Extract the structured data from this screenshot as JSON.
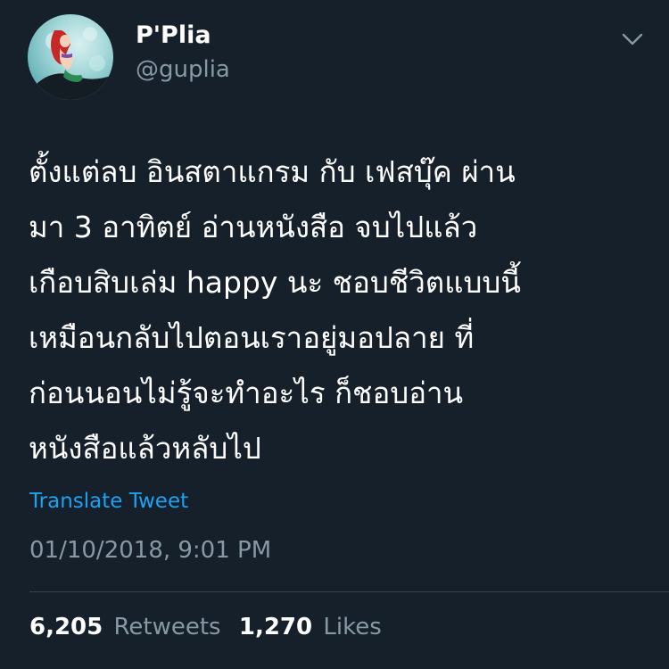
{
  "user": {
    "display_name": "P'Plia",
    "handle": "@guplia"
  },
  "tweet": {
    "text_lines": [
      "ตั้งแต่ลบ อินสตาแกรม กับ เฟสบุ๊ค ผ่าน",
      "มา 3 อาทิตย์ อ่านหนังสือ จบไปแล้ว",
      "เกือบสิบเล่ม happy นะ ชอบชีวิตแบบนี้",
      "เหมือนกลับไปตอนเราอยู่มอปลาย ที่",
      "ก่อนนอนไม่รู้จะทำอะไร ก็ชอบอ่าน",
      "หนังสือแล้วหลับไป"
    ],
    "translate_label": "Translate Tweet",
    "timestamp": "01/10/2018, 9:01 PM"
  },
  "stats": {
    "retweets_count": "6,205",
    "retweets_label": "Retweets",
    "likes_count": "1,270",
    "likes_label": "Likes"
  },
  "icons": {
    "menu": "chevron-down-icon"
  },
  "colors": {
    "background": "#15202b",
    "text_primary": "#ffffff",
    "text_secondary": "#8899a6",
    "link": "#1da1f2",
    "divider": "#38444d"
  }
}
